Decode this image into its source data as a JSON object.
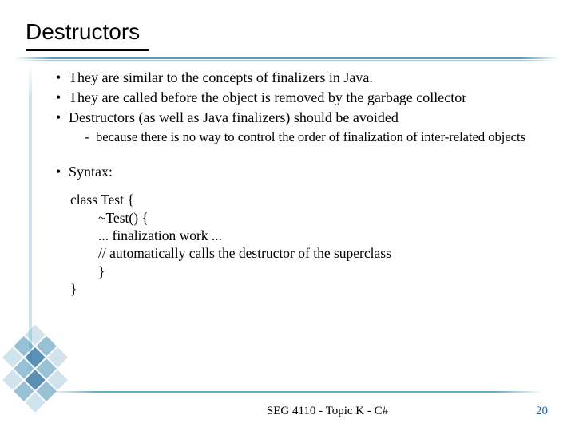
{
  "title": "Destructors",
  "bullets": [
    "They are similar to the concepts of finalizers in Java.",
    "They are called before the object is removed by the garbage collector",
    "Destructors (as well as Java finalizers) should be avoided",
    "Syntax:"
  ],
  "sub_bullets": [
    "because there is no way to control the order of finalization of inter-related objects"
  ],
  "code": [
    "class Test {",
    "~Test() {",
    "... finalization work ...",
    "// automatically calls the destructor of the superclass",
    "}",
    "}"
  ],
  "footer": {
    "text": "SEG 4110 - Topic K - C#",
    "page": "20"
  },
  "colors": {
    "accent": "#3a96b4",
    "page_number": "#1f5faa"
  }
}
